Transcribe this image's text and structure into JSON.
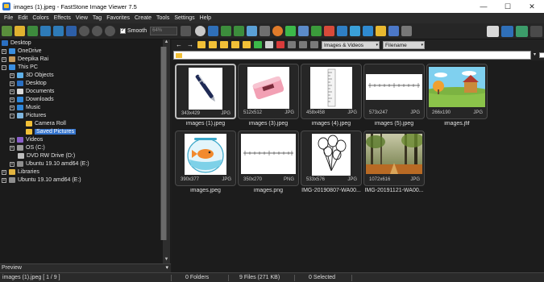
{
  "window": {
    "title": "images (1).jpeg  -  FastStone Image Viewer 7.5",
    "controls": {
      "minimize": "—",
      "maximize": "☐",
      "close": "✕"
    }
  },
  "menu": [
    "File",
    "Edit",
    "Colors",
    "Effects",
    "View",
    "Tag",
    "Favorites",
    "Create",
    "Tools",
    "Settings",
    "Help"
  ],
  "toolbar": {
    "smooth_label": "Smooth",
    "smooth_checked": "✓",
    "zoom_value": "64%"
  },
  "navigation": {
    "back": "←",
    "forward": "→",
    "filter_value": "Images & Videos",
    "sort_value": "Filename",
    "dropdown": "▾"
  },
  "path": {
    "value": "",
    "dropdown": "▾"
  },
  "tree": [
    {
      "label": "Desktop",
      "icon": "desktop-icon",
      "expander": ""
    },
    {
      "label": "OneDrive",
      "icon": "cloud-icon",
      "expander": "+"
    },
    {
      "label": "Deepika Rai",
      "icon": "user-icon",
      "expander": "+"
    },
    {
      "label": "This PC",
      "icon": "computer-icon",
      "expander": "−"
    },
    {
      "label": "3D Objects",
      "icon": "cube-icon",
      "expander": "+"
    },
    {
      "label": "Desktop",
      "icon": "desktop-icon",
      "expander": "+"
    },
    {
      "label": "Documents",
      "icon": "document-icon",
      "expander": "+"
    },
    {
      "label": "Downloads",
      "icon": "download-icon",
      "expander": "+"
    },
    {
      "label": "Music",
      "icon": "music-icon",
      "expander": "+"
    },
    {
      "label": "Pictures",
      "icon": "pictures-icon",
      "expander": "−"
    },
    {
      "label": "Camera Roll",
      "icon": "folder-icon",
      "expander": ""
    },
    {
      "label": "Saved Pictures",
      "icon": "folder-icon",
      "expander": ""
    },
    {
      "label": "Videos",
      "icon": "video-icon",
      "expander": "+"
    },
    {
      "label": "OS (C:)",
      "icon": "drive-icon",
      "expander": "+"
    },
    {
      "label": "DVD RW Drive (D:)",
      "icon": "dvd-icon",
      "expander": ""
    },
    {
      "label": "Ubuntu 19.10 amd64 (E:)",
      "icon": "usb-drive-icon",
      "expander": "+"
    },
    {
      "label": "Libraries",
      "icon": "library-icon",
      "expander": "+"
    },
    {
      "label": "Ubuntu 19.10 amd64 (E:)",
      "icon": "usb-drive-icon",
      "expander": "+"
    }
  ],
  "preview": {
    "label": "Preview",
    "toggle": "▾"
  },
  "thumbnails": [
    {
      "name": "images (1).jpeg",
      "dims": "343x429",
      "type": "JPG"
    },
    {
      "name": "images (3).jpeg",
      "dims": "512x512",
      "type": "JPG"
    },
    {
      "name": "images (4).jpeg",
      "dims": "458x458",
      "type": "JPG"
    },
    {
      "name": "images (5).jpeg",
      "dims": "573x247",
      "type": "JPG"
    },
    {
      "name": "images.jfif",
      "dims": "266x190",
      "type": "JPG"
    },
    {
      "name": "images.jpeg",
      "dims": "390x377",
      "type": "JPG"
    },
    {
      "name": "images.png",
      "dims": "350x270",
      "type": "PNG"
    },
    {
      "name": "IMG-20190807-WA00...",
      "dims": "533x576",
      "type": "JPG"
    },
    {
      "name": "IMG-20191121-WA00...",
      "dims": "1072x616",
      "type": "JPG"
    }
  ],
  "status": {
    "file": "images (1).jpeg [ 1 / 9 ]",
    "folders": "0 Folders",
    "files": "9 Files (271 KB)",
    "selected": "0 Selected"
  }
}
